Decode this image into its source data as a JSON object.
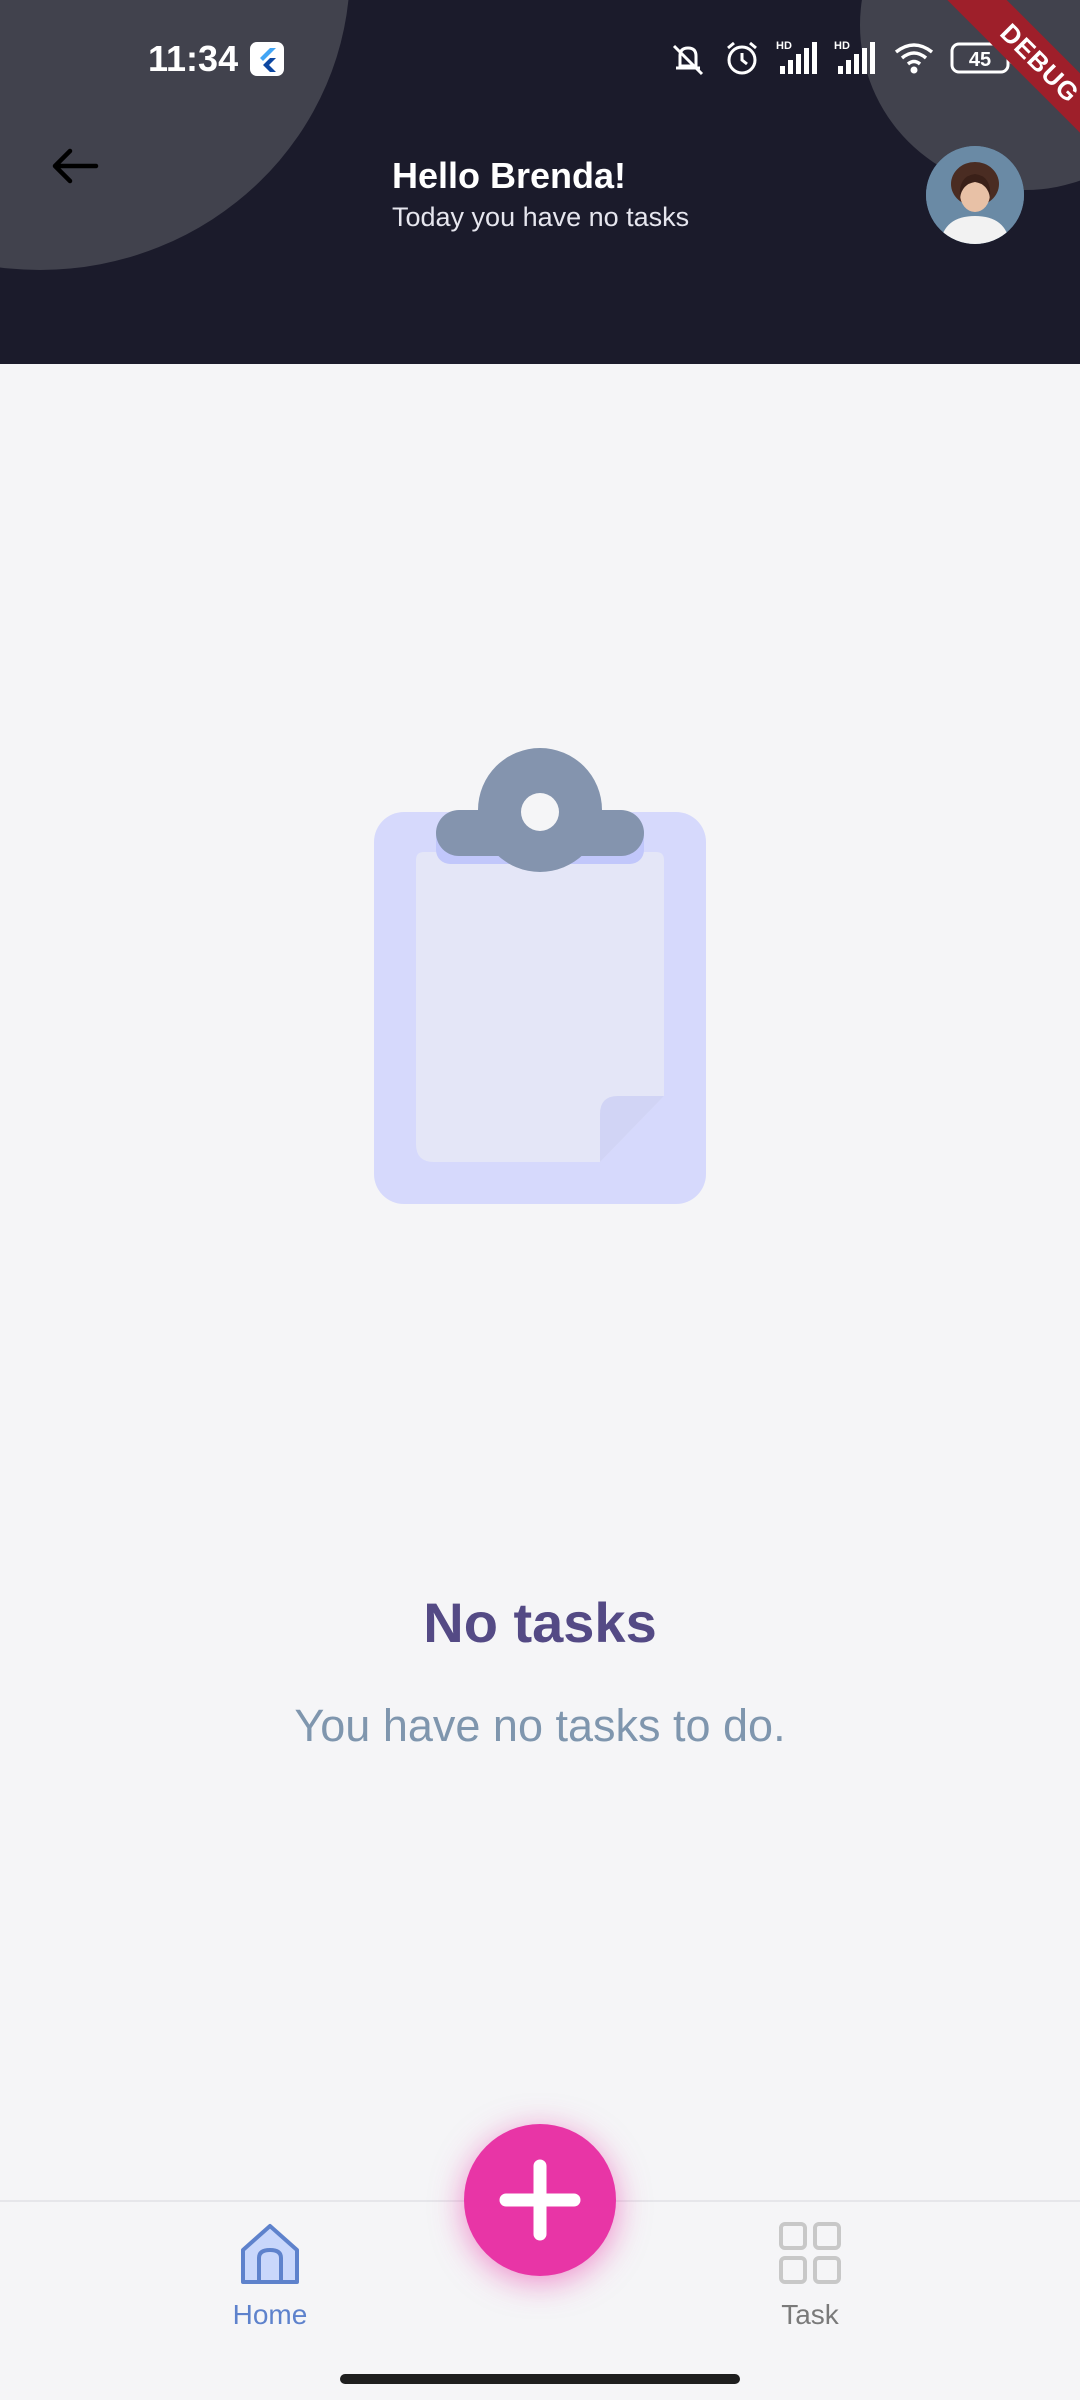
{
  "status_bar": {
    "time": "11:34",
    "battery_level": "45",
    "debug_banner": "DEBUG"
  },
  "header": {
    "greeting": "Hello Brenda!",
    "subtitle": "Today you have no tasks"
  },
  "empty_state": {
    "title": "No tasks",
    "message": "You have no tasks to do."
  },
  "bottom_nav": {
    "items": [
      {
        "label": "Home",
        "icon": "home-icon",
        "active": true
      },
      {
        "label": "Task",
        "icon": "grid-icon",
        "active": false
      }
    ]
  },
  "fab": {
    "icon": "plus-icon"
  },
  "colors": {
    "header_bg": "#1b1b2b",
    "accent_pink": "#e835a6",
    "title_purple": "#544a85",
    "active_blue": "#5e82cc"
  }
}
